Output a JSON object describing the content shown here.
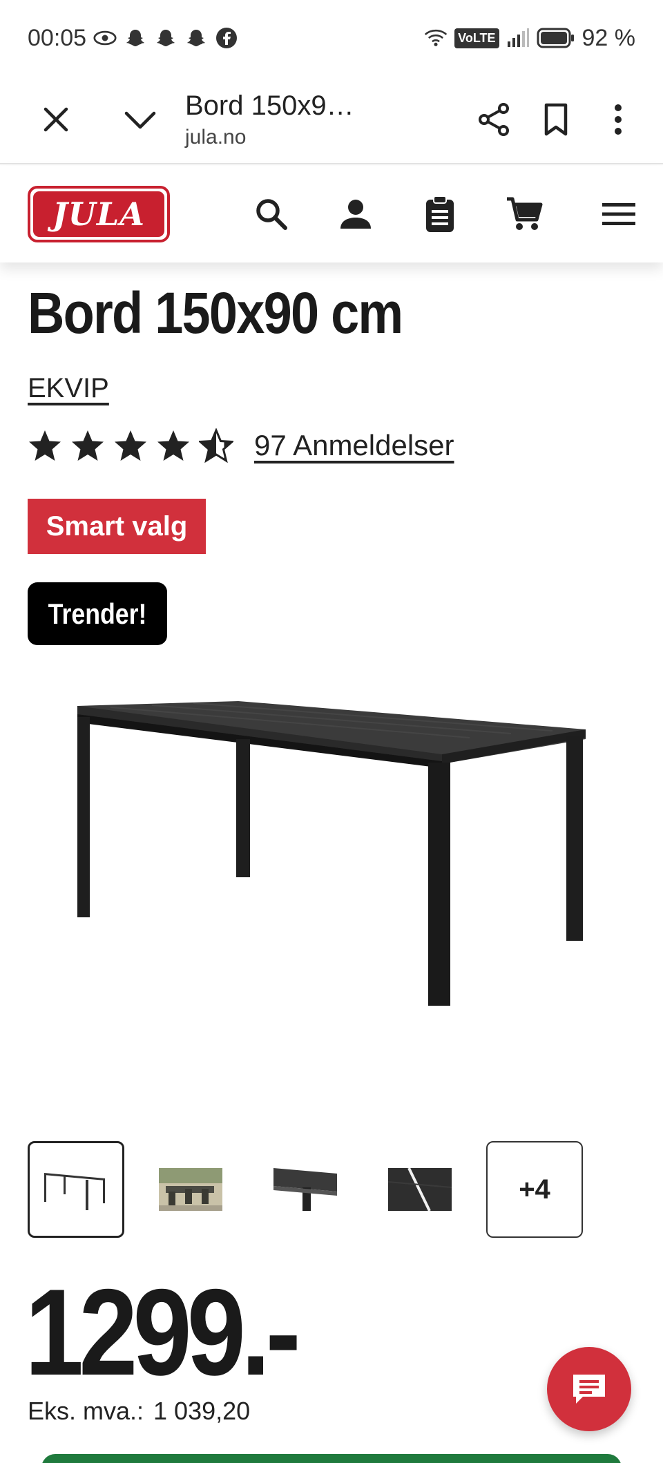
{
  "status_bar": {
    "time": "00:05",
    "battery": "92 %",
    "network": "VoLTE"
  },
  "browser": {
    "title": "Bord 150x9…",
    "url": "jula.no"
  },
  "site": {
    "logo_text": "JULA",
    "brand_color": "#c8202f"
  },
  "product": {
    "title": "Bord 150x90 cm",
    "brand": "EKVIP",
    "rating": 4.5,
    "reviews_label": "97 Anmeldelser",
    "badge_smart": "Smart valg",
    "badge_trend": "Trender!",
    "thumbnails_more": "+4",
    "price": "1299.-",
    "price_ex_label": "Eks. mva.:",
    "price_ex_value": "1 039,20"
  },
  "icons": {
    "status": [
      "eye-icon",
      "snapchat-icon",
      "snapchat-icon",
      "snapchat-icon",
      "facebook-icon",
      "wifi-icon",
      "signal-icon",
      "battery-icon"
    ],
    "browser": [
      "close-icon",
      "chevron-down-icon",
      "share-icon",
      "bookmark-icon",
      "more-vertical-icon"
    ],
    "header": [
      "search-icon",
      "user-icon",
      "clipboard-icon",
      "cart-icon",
      "menu-icon"
    ],
    "chat": "chat-icon"
  }
}
